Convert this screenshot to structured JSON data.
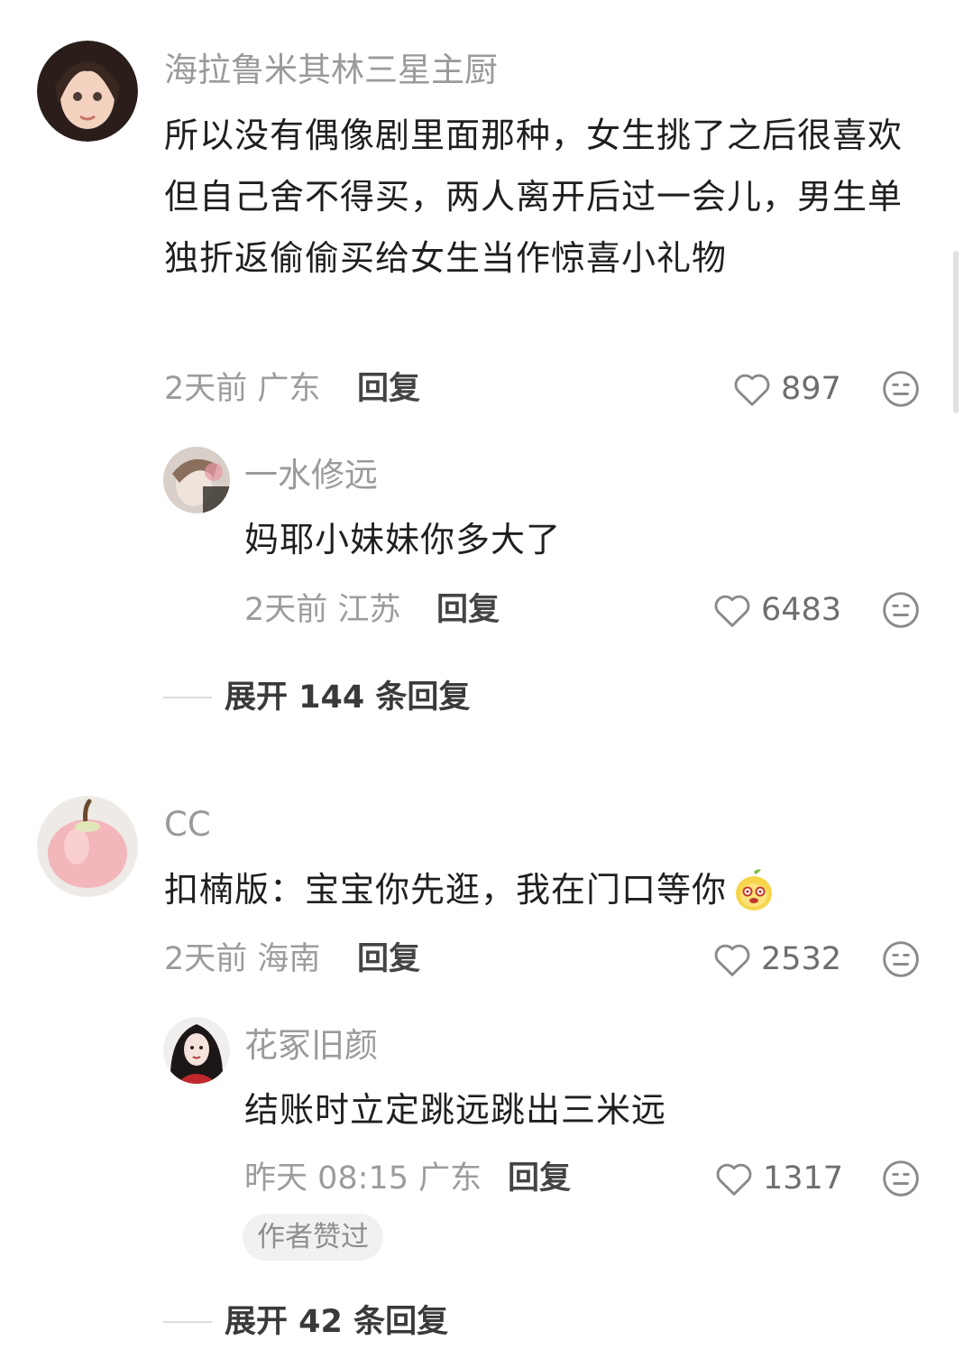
{
  "comments": [
    {
      "username": "海拉鲁米其林三星主厨",
      "text": "所以没有偶像剧里面那种，女生挑了之后很喜欢但自己舍不得买，两人离开后过一会儿，男生单独折返偷偷买给女生当作惊喜小礼物",
      "time_location": "2天前 广东",
      "reply_label": "回复",
      "likes": "897",
      "replies": [
        {
          "username": "一水修远",
          "text": "妈耶小妹妹你多大了",
          "time_location": "2天前 江苏",
          "reply_label": "回复",
          "likes": "6483"
        }
      ],
      "expand_label": "展开 144 条回复"
    },
    {
      "username": "CC",
      "text": "扣楠版：宝宝你先逛，我在门口等你",
      "time_location": "2天前 海南",
      "reply_label": "回复",
      "likes": "2532",
      "replies": [
        {
          "username": "花冢旧颜",
          "text": "结账时立定跳远跳出三米远",
          "time_location": "昨天 08:15 广东",
          "reply_label": "回复",
          "likes": "1317",
          "badge": "作者赞过"
        }
      ],
      "expand_label": "展开 42 条回复"
    }
  ],
  "icons": {
    "like": "heart-outline-icon",
    "dislike": "neutral-face-icon",
    "emoji": "mango-emoji-icon"
  },
  "colors": {
    "primary_text": "#1f1f1f",
    "secondary_text": "#9a9a9a",
    "badge_bg": "#f1f1f1"
  }
}
